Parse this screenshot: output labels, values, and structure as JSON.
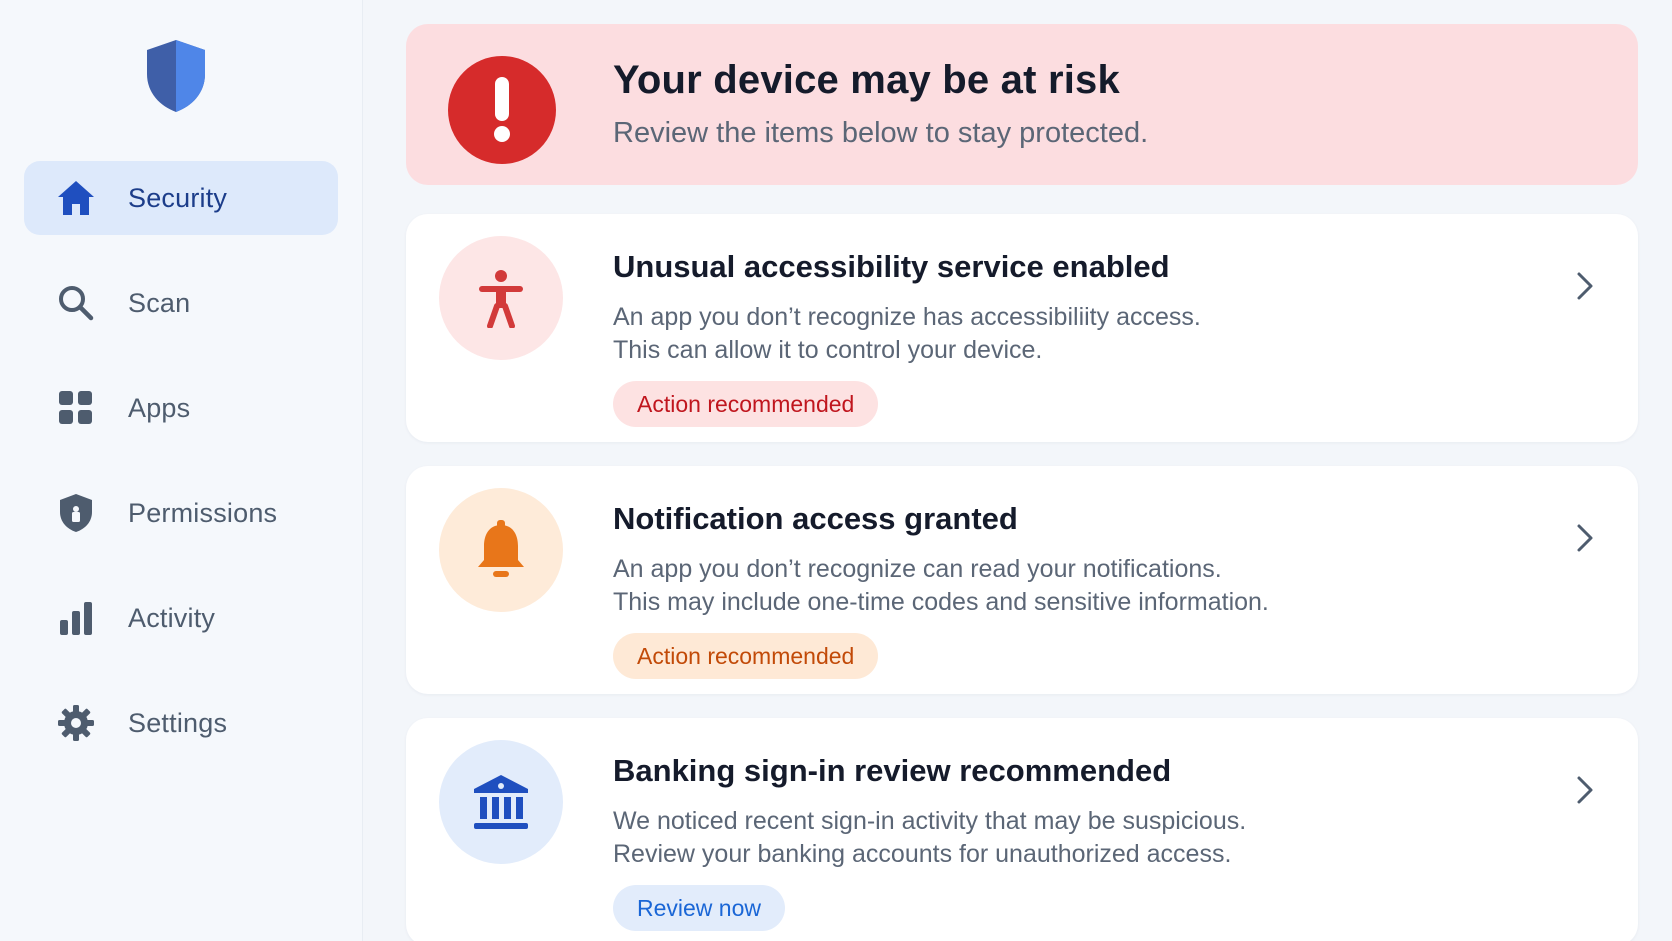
{
  "sidebar": {
    "logo_icon": "shield-logo-icon",
    "items": [
      {
        "label": "Security",
        "icon": "home-icon",
        "active": true
      },
      {
        "label": "Scan",
        "icon": "search-icon"
      },
      {
        "label": "Apps",
        "icon": "grid-icon"
      },
      {
        "label": "Permissions",
        "icon": "shield-lock-icon"
      },
      {
        "label": "Activity",
        "icon": "bar-chart-icon"
      },
      {
        "label": "Settings",
        "icon": "gear-icon"
      }
    ]
  },
  "alert": {
    "title": "Your device may be at risk",
    "subtitle": "Review the items below to stay protected.",
    "icon": "exclamation-icon",
    "color": "#d62b2b"
  },
  "cards": [
    {
      "title": "Unusual accessibility service enabled",
      "line1": "An app you don’t recognize has accessibiliity access.",
      "line2": "This can allow it to control your device.",
      "badge": "Action recommended",
      "icon": "accessibility-icon",
      "accent": "#d23a3a"
    },
    {
      "title": "Notification access granted",
      "line1": "An app you don’t recognize can read your notifications.",
      "line2": "This may include one-time codes and sensitive information.",
      "badge": "Action recommended",
      "icon": "bell-icon",
      "accent": "#e8761a"
    },
    {
      "title": "Banking sign-in review recommended",
      "line1": "We noticed recent sign-in activity that may be suspicious.",
      "line2": "Review your banking accounts for unauthorized access.",
      "badge": "Review now",
      "icon": "bank-icon",
      "accent": "#1f4fbf"
    }
  ]
}
